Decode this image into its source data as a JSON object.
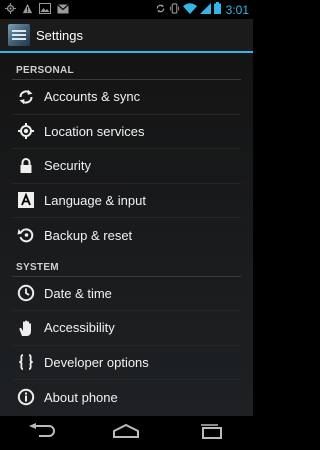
{
  "status_bar": {
    "time": "3:01",
    "left_icons": [
      "gps-icon",
      "warning-icon",
      "image-icon",
      "gmail-icon"
    ],
    "right_icons": [
      "sync-icon",
      "vibrate-icon",
      "wifi-icon",
      "signal-icon",
      "battery-icon"
    ]
  },
  "action_bar": {
    "title": "Settings",
    "accent_color": "#33b5e5"
  },
  "sections": [
    {
      "header": "PERSONAL",
      "items": [
        {
          "label": "Accounts & sync",
          "icon": "sync-icon"
        },
        {
          "label": "Location services",
          "icon": "location-icon"
        },
        {
          "label": "Security",
          "icon": "lock-icon"
        },
        {
          "label": "Language & input",
          "icon": "language-icon"
        },
        {
          "label": "Backup & reset",
          "icon": "backup-icon"
        }
      ]
    },
    {
      "header": "SYSTEM",
      "items": [
        {
          "label": "Date & time",
          "icon": "clock-icon"
        },
        {
          "label": "Accessibility",
          "icon": "hand-icon"
        },
        {
          "label": "Developer options",
          "icon": "braces-icon"
        },
        {
          "label": "About phone",
          "icon": "info-icon"
        }
      ]
    }
  ],
  "nav_bar": {
    "buttons": [
      "back-icon",
      "home-icon",
      "recent-apps-icon"
    ]
  }
}
